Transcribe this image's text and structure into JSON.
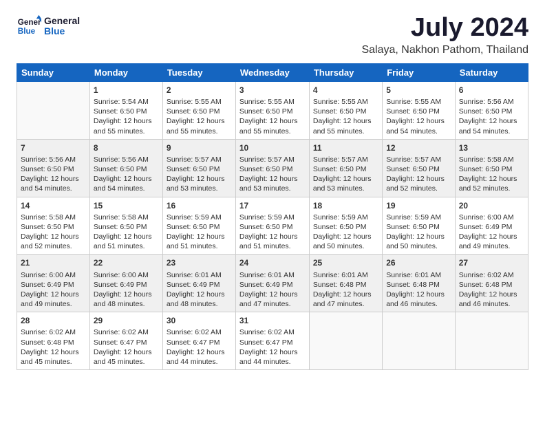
{
  "logo": {
    "line1": "General",
    "line2": "Blue"
  },
  "title": "July 2024",
  "location": "Salaya, Nakhon Pathom, Thailand",
  "days_of_week": [
    "Sunday",
    "Monday",
    "Tuesday",
    "Wednesday",
    "Thursday",
    "Friday",
    "Saturday"
  ],
  "weeks": [
    [
      {
        "day": "",
        "text": ""
      },
      {
        "day": "1",
        "text": "Sunrise: 5:54 AM\nSunset: 6:50 PM\nDaylight: 12 hours\nand 55 minutes."
      },
      {
        "day": "2",
        "text": "Sunrise: 5:55 AM\nSunset: 6:50 PM\nDaylight: 12 hours\nand 55 minutes."
      },
      {
        "day": "3",
        "text": "Sunrise: 5:55 AM\nSunset: 6:50 PM\nDaylight: 12 hours\nand 55 minutes."
      },
      {
        "day": "4",
        "text": "Sunrise: 5:55 AM\nSunset: 6:50 PM\nDaylight: 12 hours\nand 55 minutes."
      },
      {
        "day": "5",
        "text": "Sunrise: 5:55 AM\nSunset: 6:50 PM\nDaylight: 12 hours\nand 54 minutes."
      },
      {
        "day": "6",
        "text": "Sunrise: 5:56 AM\nSunset: 6:50 PM\nDaylight: 12 hours\nand 54 minutes."
      }
    ],
    [
      {
        "day": "7",
        "text": "Sunrise: 5:56 AM\nSunset: 6:50 PM\nDaylight: 12 hours\nand 54 minutes."
      },
      {
        "day": "8",
        "text": "Sunrise: 5:56 AM\nSunset: 6:50 PM\nDaylight: 12 hours\nand 54 minutes."
      },
      {
        "day": "9",
        "text": "Sunrise: 5:57 AM\nSunset: 6:50 PM\nDaylight: 12 hours\nand 53 minutes."
      },
      {
        "day": "10",
        "text": "Sunrise: 5:57 AM\nSunset: 6:50 PM\nDaylight: 12 hours\nand 53 minutes."
      },
      {
        "day": "11",
        "text": "Sunrise: 5:57 AM\nSunset: 6:50 PM\nDaylight: 12 hours\nand 53 minutes."
      },
      {
        "day": "12",
        "text": "Sunrise: 5:57 AM\nSunset: 6:50 PM\nDaylight: 12 hours\nand 52 minutes."
      },
      {
        "day": "13",
        "text": "Sunrise: 5:58 AM\nSunset: 6:50 PM\nDaylight: 12 hours\nand 52 minutes."
      }
    ],
    [
      {
        "day": "14",
        "text": "Sunrise: 5:58 AM\nSunset: 6:50 PM\nDaylight: 12 hours\nand 52 minutes."
      },
      {
        "day": "15",
        "text": "Sunrise: 5:58 AM\nSunset: 6:50 PM\nDaylight: 12 hours\nand 51 minutes."
      },
      {
        "day": "16",
        "text": "Sunrise: 5:59 AM\nSunset: 6:50 PM\nDaylight: 12 hours\nand 51 minutes."
      },
      {
        "day": "17",
        "text": "Sunrise: 5:59 AM\nSunset: 6:50 PM\nDaylight: 12 hours\nand 51 minutes."
      },
      {
        "day": "18",
        "text": "Sunrise: 5:59 AM\nSunset: 6:50 PM\nDaylight: 12 hours\nand 50 minutes."
      },
      {
        "day": "19",
        "text": "Sunrise: 5:59 AM\nSunset: 6:50 PM\nDaylight: 12 hours\nand 50 minutes."
      },
      {
        "day": "20",
        "text": "Sunrise: 6:00 AM\nSunset: 6:49 PM\nDaylight: 12 hours\nand 49 minutes."
      }
    ],
    [
      {
        "day": "21",
        "text": "Sunrise: 6:00 AM\nSunset: 6:49 PM\nDaylight: 12 hours\nand 49 minutes."
      },
      {
        "day": "22",
        "text": "Sunrise: 6:00 AM\nSunset: 6:49 PM\nDaylight: 12 hours\nand 48 minutes."
      },
      {
        "day": "23",
        "text": "Sunrise: 6:01 AM\nSunset: 6:49 PM\nDaylight: 12 hours\nand 48 minutes."
      },
      {
        "day": "24",
        "text": "Sunrise: 6:01 AM\nSunset: 6:49 PM\nDaylight: 12 hours\nand 47 minutes."
      },
      {
        "day": "25",
        "text": "Sunrise: 6:01 AM\nSunset: 6:48 PM\nDaylight: 12 hours\nand 47 minutes."
      },
      {
        "day": "26",
        "text": "Sunrise: 6:01 AM\nSunset: 6:48 PM\nDaylight: 12 hours\nand 46 minutes."
      },
      {
        "day": "27",
        "text": "Sunrise: 6:02 AM\nSunset: 6:48 PM\nDaylight: 12 hours\nand 46 minutes."
      }
    ],
    [
      {
        "day": "28",
        "text": "Sunrise: 6:02 AM\nSunset: 6:48 PM\nDaylight: 12 hours\nand 45 minutes."
      },
      {
        "day": "29",
        "text": "Sunrise: 6:02 AM\nSunset: 6:47 PM\nDaylight: 12 hours\nand 45 minutes."
      },
      {
        "day": "30",
        "text": "Sunrise: 6:02 AM\nSunset: 6:47 PM\nDaylight: 12 hours\nand 44 minutes."
      },
      {
        "day": "31",
        "text": "Sunrise: 6:02 AM\nSunset: 6:47 PM\nDaylight: 12 hours\nand 44 minutes."
      },
      {
        "day": "",
        "text": ""
      },
      {
        "day": "",
        "text": ""
      },
      {
        "day": "",
        "text": ""
      }
    ]
  ]
}
